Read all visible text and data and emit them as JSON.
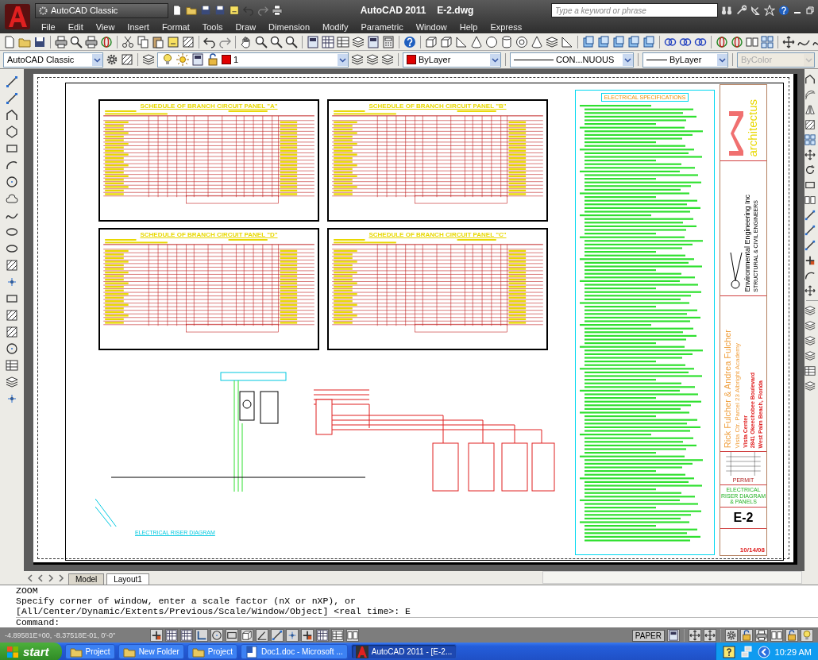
{
  "title_bar": {
    "workspace": "AutoCAD Classic",
    "app_title": "AutoCAD 2011",
    "file_name": "E-2.dwg",
    "search": {
      "placeholder": "Type a keyword or phrase"
    }
  },
  "menu_bar": [
    "File",
    "Edit",
    "View",
    "Insert",
    "Format",
    "Tools",
    "Draw",
    "Dimension",
    "Modify",
    "Parametric",
    "Window",
    "Help",
    "Express"
  ],
  "properties_toolbar": {
    "dropdowns": [
      {
        "kind": "workspace",
        "value": "AutoCAD Classic",
        "disabled": false
      },
      {
        "kind": "layer",
        "value": "1",
        "disabled": false
      },
      {
        "kind": "color",
        "value": "ByLayer",
        "disabled": false
      },
      {
        "kind": "linetype",
        "value": "CON...NUOUS",
        "disabled": false
      },
      {
        "kind": "lineweight",
        "value": "ByLayer",
        "disabled": false
      },
      {
        "kind": "plotstyle",
        "value": "ByColor",
        "disabled": true
      }
    ]
  },
  "sheet": {
    "schedules": [
      {
        "title": "SCHEDULE OF BRANCH CIRCUIT PANEL \"A\""
      },
      {
        "title": "SCHEDULE OF BRANCH CIRCUIT PANEL \"B\""
      },
      {
        "title": "SCHEDULE OF BRANCH CIRCUIT PANEL \"D\""
      },
      {
        "title": "SCHEDULE OF BRANCH CIRCUIT PANEL \"C\""
      }
    ],
    "riser": {
      "title": "ELECTRICAL RISER DIAGRAM"
    },
    "specifications": {
      "title": "ELECTRICAL SPECIFICATIONS"
    },
    "title_block": {
      "firm": "architectus",
      "engineer": "Environmental Engineering Inc",
      "engineer_subtitle": "STRUCTURAL & CIVIL ENGINEERS",
      "client": "Rick Fulcher & Andrea Fulcher",
      "project": "Vista Ctr. Parcel 23 Albright Academy",
      "address": [
        "Vista Center",
        "2841 Okeechobee Boulevard",
        "West Palm Beach, Florida"
      ],
      "status": "PERMIT",
      "sheet_title": "ELECTRICAL RISER DIAGRAM & PANELS",
      "sheet_number": "E-2",
      "date": "10/14/08"
    }
  },
  "layout_tabs": [
    {
      "label": "Model",
      "selected": false
    },
    {
      "label": "Layout1",
      "selected": true
    }
  ],
  "command_window": {
    "history": [
      "ZOOM",
      "Specify corner of window, enter a scale factor (nX or nXP), or",
      "[All/Center/Dynamic/Extents/Previous/Scale/Window/Object] <real time>: E"
    ],
    "prompt": "Command:"
  },
  "status_bar": {
    "coordinates": "-4.89581E+00, -8.37518E-01, 0'-0\"",
    "space": "PAPER"
  },
  "taskbar": {
    "start": "start",
    "items": [
      {
        "label": "Project",
        "kind": "folder",
        "selected": false
      },
      {
        "label": "New Folder",
        "kind": "folder",
        "selected": false
      },
      {
        "label": "Project",
        "kind": "folder",
        "selected": false
      },
      {
        "label": "Doc1.doc - Microsoft ...",
        "kind": "document",
        "selected": false
      },
      {
        "label": "AutoCAD 2011 - [E-2...",
        "kind": "autocad",
        "selected": true
      }
    ],
    "clock": "10:29 AM"
  }
}
